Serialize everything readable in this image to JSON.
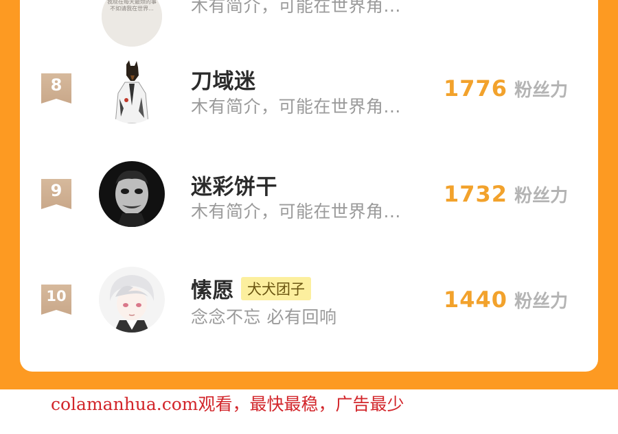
{
  "top_partial": {
    "avatar_text_line1": "我现在每天最烦的事",
    "avatar_text_line2": "不如请我在世界...",
    "desc": "木有简介，可能在世界角..."
  },
  "rankings": [
    {
      "rank": "8",
      "name": "刀域迷",
      "badge": "",
      "desc": "木有简介，可能在世界角...",
      "fans": "1776",
      "fans_label": "粉丝力"
    },
    {
      "rank": "9",
      "name": "迷彩饼干",
      "badge": "",
      "desc": "木有简介，可能在世界角...",
      "fans": "1732",
      "fans_label": "粉丝力"
    },
    {
      "rank": "10",
      "name": "愫愿",
      "badge": "犬犬团子",
      "desc": "念念不忘 必有回响",
      "fans": "1440",
      "fans_label": "粉丝力"
    }
  ],
  "footer": {
    "text": "colamanhua.com观看，最快最稳，广告最少"
  },
  "colors": {
    "background_orange": "#fd9a22",
    "fans_number": "#f2a22c",
    "rank_badge": "#d6b99c",
    "footer_red": "#d2252a"
  }
}
